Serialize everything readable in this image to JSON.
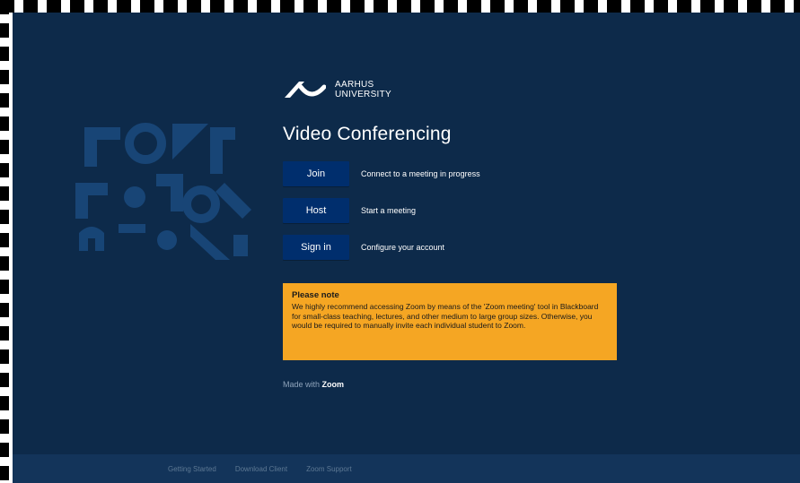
{
  "logo": {
    "line1": "AARHUS",
    "line2": "UNIVERSITY"
  },
  "page": {
    "title": "Video Conferencing"
  },
  "actions": [
    {
      "label": "Join",
      "description": "Connect to a meeting in progress"
    },
    {
      "label": "Host",
      "description": "Start a meeting"
    },
    {
      "label": "Sign in",
      "description": "Configure your account"
    }
  ],
  "notice": {
    "title": "Please note",
    "body": "We highly recommend accessing Zoom by means of the 'Zoom meeting' tool in Blackboard for small-class teaching, lectures, and other medium to large group sizes. Otherwise, you would be required to manually invite each individual student to Zoom."
  },
  "made_with": {
    "prefix": "Made with",
    "brand": "Zoom"
  },
  "footer": {
    "links": [
      "Getting Started",
      "Download Client",
      "Zoom Support"
    ]
  },
  "colors": {
    "background": "#0d2a4a",
    "button": "#002e6d",
    "notice": "#f5a623",
    "footer": "#13345a"
  }
}
